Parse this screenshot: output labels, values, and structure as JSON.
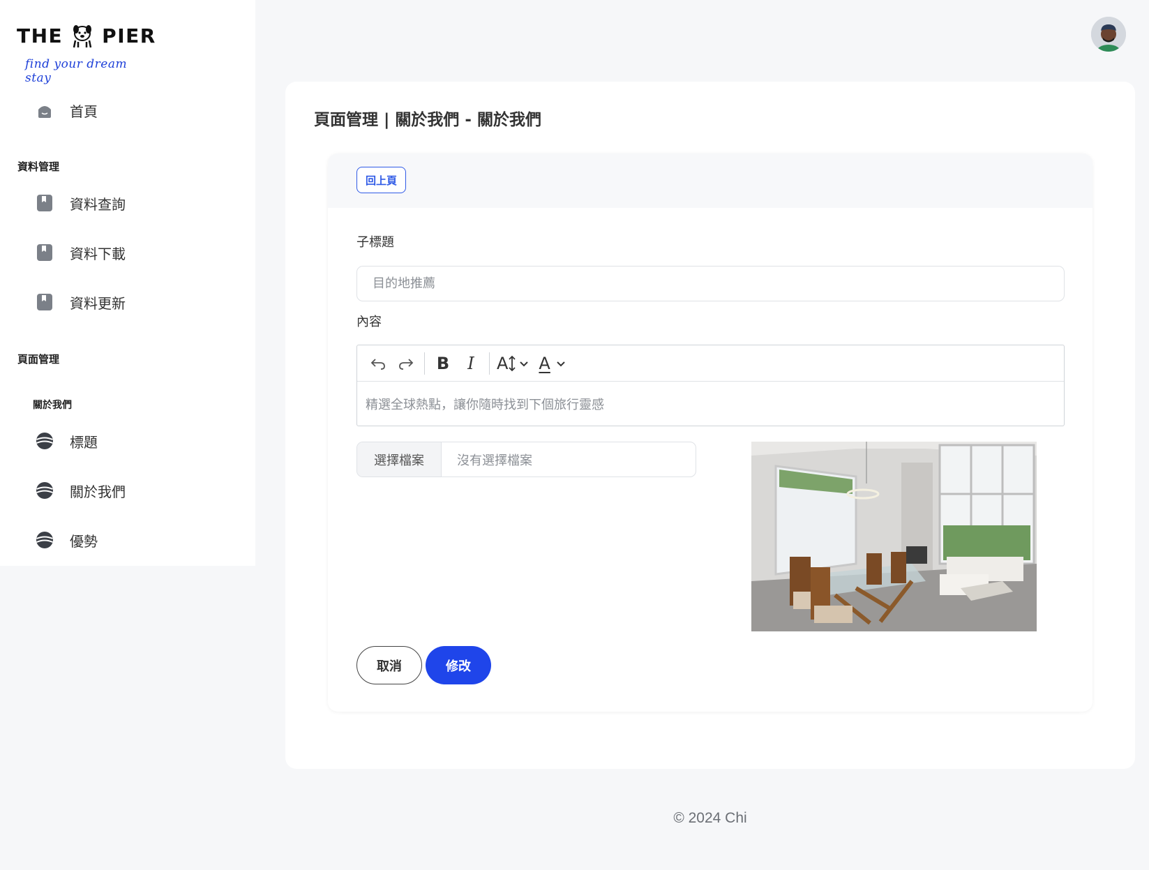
{
  "brand": {
    "name_left": "THE",
    "name_right": "PIER",
    "tagline": "find your dream stay",
    "tagline_color": "#1d3fd8"
  },
  "sidebar": {
    "home": {
      "label": "首頁",
      "icon": "home-icon"
    },
    "data_section": {
      "title": "資料管理",
      "items": [
        {
          "label": "資料查詢",
          "icon": "bookmark-icon"
        },
        {
          "label": "資料下載",
          "icon": "bookmark-icon"
        },
        {
          "label": "資料更新",
          "icon": "bookmark-icon"
        }
      ]
    },
    "page_section": {
      "title": "頁面管理",
      "subsection": "關於我們",
      "items": [
        {
          "label": "標題",
          "icon": "globe-icon"
        },
        {
          "label": "關於我們",
          "icon": "globe-icon"
        },
        {
          "label": "優勢",
          "icon": "globe-icon"
        }
      ]
    }
  },
  "main": {
    "title": "頁面管理 | 關於我們 - 關於我們",
    "back_label": "回上頁",
    "subtitle_label": "子標題",
    "subtitle_placeholder": "目的地推薦",
    "content_label": "內容",
    "content_placeholder": "精選全球熱點，讓你隨時找到下個旅行靈感",
    "toolbar": {
      "undo": "undo-icon",
      "redo": "redo-icon",
      "bold": "B",
      "italic": "I",
      "font_size": "A",
      "font_color": "A"
    },
    "file_button": "選擇檔案",
    "file_status": "沒有選擇檔案",
    "cancel_label": "取消",
    "submit_label": "修改",
    "accent_color": "#1f45ea"
  },
  "footer": {
    "text": "© 2024 Chi"
  }
}
